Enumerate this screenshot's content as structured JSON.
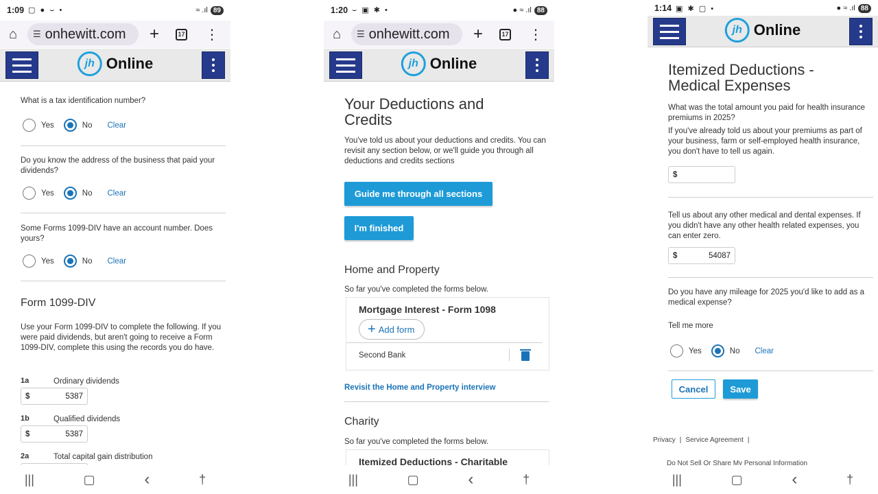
{
  "phone1": {
    "status": {
      "time": "1:09",
      "icons": "▢ ● ⌣ •",
      "battery": "89"
    },
    "browser": {
      "url": "onhewitt.com",
      "tabs": "17"
    },
    "brand": "Online",
    "tin_link": "What is a tax identification number?",
    "q_business": "Do you know the address of the business that paid your dividends?",
    "q_account": "Some Forms 1099-DIV have an account number. Does yours?",
    "yes": "Yes",
    "no": "No",
    "clear": "Clear",
    "section_title": "Form 1099-DIV",
    "section_desc": "Use your Form 1099-DIV to complete the following. If you were paid dividends, but aren't going to receive a Form 1099-DIV, complete this using the records you do have.",
    "fields": [
      {
        "code": "1a",
        "label": "Ordinary dividends",
        "value": "5387"
      },
      {
        "code": "1b",
        "label": "Qualified dividends",
        "value": "5387"
      },
      {
        "code": "2a",
        "label": "Total capital gain distribution",
        "value": ""
      }
    ],
    "dollar": "$"
  },
  "phone2": {
    "status": {
      "time": "1:20",
      "icons": "⌣ ▣ ✱ •",
      "battery": "88"
    },
    "browser": {
      "url": "onhewitt.com",
      "tabs": "17"
    },
    "brand": "Online",
    "title": "Your Deductions and Credits",
    "intro": "You've told us about your deductions and credits. You can revisit any section below, or we'll guide you through all deductions and credits sections",
    "guide_btn": "Guide me through all sections",
    "finished_btn": "I'm finished",
    "home_title": "Home and Property",
    "completed_text": "So far you've completed the forms below.",
    "mortgage_title": "Mortgage Interest - Form 1098",
    "add_form": "Add form",
    "lender": "Second Bank",
    "revisit_link": "Revisit the Home and Property interview",
    "charity_title": "Charity",
    "charity_completed": "So far you've completed the forms below.",
    "charity_card_title": "Itemized Deductions - Charitable"
  },
  "phone3": {
    "status": {
      "time": "1:14",
      "icons": "▣ ✱ ▢ •",
      "battery": "88"
    },
    "brand": "Online",
    "title": "Itemized Deductions - Medical Expenses",
    "q_premiums": "What was the total amount you paid for health insurance premiums in 2025?",
    "premiums_note": "If you've already told us about your premiums as part of your business, farm or self-employed health insurance, you don't have to tell us again.",
    "premiums_value": "",
    "q_other": "Tell us about any other medical and dental expenses. If you didn't have any other health related expenses, you can enter zero.",
    "other_value": "54087",
    "q_mileage": "Do you have any mileage for 2025 you'd like to add as a medical expense?",
    "tell_more": "Tell me more",
    "yes": "Yes",
    "no": "No",
    "clear": "Clear",
    "cancel": "Cancel",
    "save": "Save",
    "footer_privacy": "Privacy",
    "footer_sep": "|",
    "footer_service": "Service Agreement",
    "footer_dns": "Do Not Sell Or Share My Personal Information",
    "dollar": "$"
  },
  "nav": {
    "recents": "|||",
    "home": "▢",
    "back": "‹",
    "a11y": "†"
  },
  "colors": {
    "header_blue": "#263a8c",
    "accent_blue": "#1e9bd7",
    "link_blue": "#1a73b8"
  },
  "icons": [
    "home-icon",
    "tune-icon",
    "plus-icon",
    "tabs-icon",
    "more-vert-icon",
    "hamburger-icon",
    "trash-icon",
    "accessibility-icon"
  ]
}
